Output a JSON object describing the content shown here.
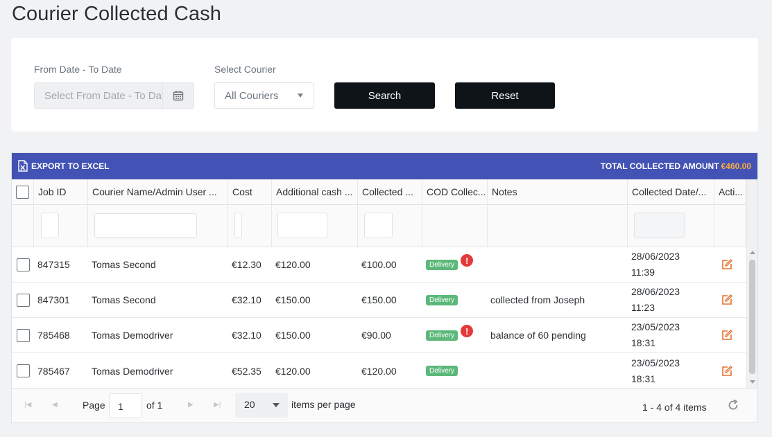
{
  "page": {
    "title": "Courier Collected Cash"
  },
  "filters": {
    "date_label": "From Date - To Date",
    "date_placeholder": "Select From Date - To Date",
    "courier_label": "Select Courier",
    "courier_value": "All Couriers",
    "search_label": "Search",
    "reset_label": "Reset"
  },
  "toolbar": {
    "export_label": "EXPORT TO EXCEL",
    "total_label": "TOTAL COLLECTED AMOUNT",
    "total_amount": "€460.00",
    "total_color": "#ffab40",
    "bar_color": "#4353b5"
  },
  "columns": [
    "Job ID",
    "Courier Name/Admin User ...",
    "Cost",
    "Additional cash ...",
    "Collected ...",
    "COD Collec...",
    "Notes",
    "Collected Date/...",
    "Acti..."
  ],
  "rows": [
    {
      "job_id": "847315",
      "courier": "Tomas Second",
      "cost": "€12.30",
      "additional": "€120.00",
      "collected": "€100.00",
      "badge": "Delivery",
      "alert": "!",
      "notes": "",
      "date": "28/06/2023",
      "time": "11:39"
    },
    {
      "job_id": "847301",
      "courier": "Tomas Second",
      "cost": "€32.10",
      "additional": "€150.00",
      "collected": "€150.00",
      "badge": "Delivery",
      "alert": "",
      "notes": "collected from Joseph",
      "date": "28/06/2023",
      "time": "11:23"
    },
    {
      "job_id": "785468",
      "courier": "Tomas Demodriver",
      "cost": "€32.10",
      "additional": "€150.00",
      "collected": "€90.00",
      "badge": "Delivery",
      "alert": "!",
      "notes": "balance of 60 pending",
      "date": "23/05/2023",
      "time": "18:31"
    },
    {
      "job_id": "785467",
      "courier": "Tomas Demodriver",
      "cost": "€52.35",
      "additional": "€120.00",
      "collected": "€120.00",
      "badge": "Delivery",
      "alert": "",
      "notes": "",
      "date": "23/05/2023",
      "time": "18:31"
    }
  ],
  "icons": {
    "export": "excel-icon",
    "calendar": "calendar-icon",
    "edit": "edit-icon",
    "alert": "alert-icon",
    "refresh": "refresh-icon"
  },
  "pager": {
    "page_label": "Page",
    "page_value": "1",
    "of_label": "of 1",
    "per_page_value": "20",
    "per_page_label": "items per page",
    "summary": "1 - 4 of 4 items"
  }
}
